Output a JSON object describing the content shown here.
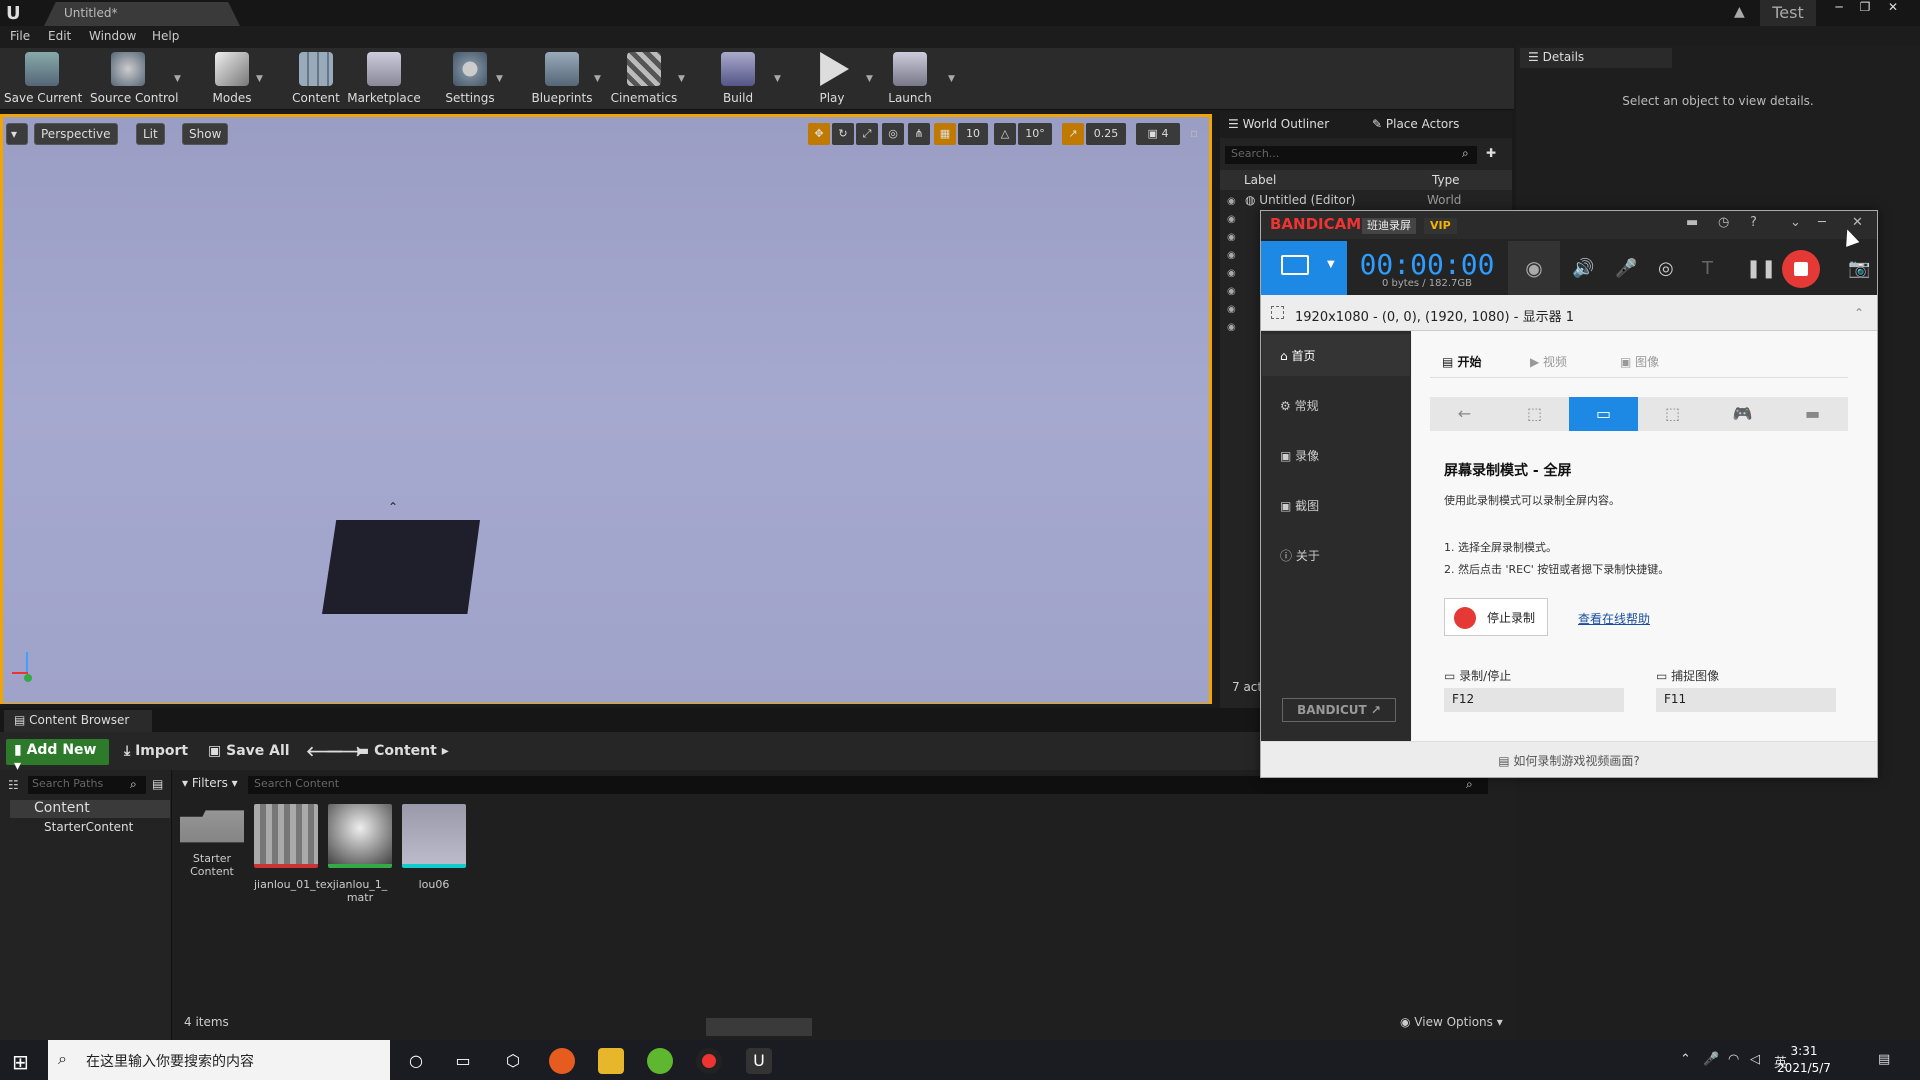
{
  "window": {
    "tab_title": "Untitled*",
    "user_label": "Test"
  },
  "menu": [
    "File",
    "Edit",
    "Window",
    "Help"
  ],
  "toolbar": {
    "items": [
      "Save Current",
      "Source Control",
      "Modes",
      "Content",
      "Marketplace",
      "Settings",
      "Blueprints",
      "Cinematics",
      "Build",
      "Play",
      "Launch"
    ]
  },
  "viewport": {
    "perspective": "Perspective",
    "lit": "Lit",
    "show": "Show",
    "grid_snap": "10",
    "rotation_snap": "10°",
    "scale_snap": "0.25",
    "camera_speed": "4"
  },
  "outliner": {
    "tab_world": "World Outliner",
    "tab_place": "Place Actors",
    "search_placeholder": "Search...",
    "col_label": "Label",
    "col_type": "Type",
    "row_label": "Untitled (Editor)",
    "row_type": "World",
    "actor_count": "7 act"
  },
  "details": {
    "tab": "Details",
    "message": "Select an object to view details."
  },
  "content_browser": {
    "tab": "Content Browser",
    "add_new": "Add New",
    "import": "Import",
    "save_all": "Save All",
    "path": "Content",
    "search_paths_placeholder": "Search Paths",
    "filters": "Filters",
    "search_content_placeholder": "Search Content",
    "tree": [
      "Content",
      "StarterContent"
    ],
    "assets": [
      {
        "label": "Starter Content"
      },
      {
        "label": "jianlou_01_tex"
      },
      {
        "label": "jianlou_1_ matr"
      },
      {
        "label": "lou06"
      }
    ],
    "items_count": "4 items",
    "view_options": "View Options"
  },
  "taskbar": {
    "search_placeholder": "在这里输入你要搜索的内容",
    "time": "3:31",
    "date": "2021/5/7",
    "ime": "英"
  },
  "bandicam": {
    "brand": "BANDICAM",
    "brand_cn": "班迪录屏",
    "vip": "VIP",
    "timer": "00:00:00",
    "size_info": "0 bytes / 182.7GB",
    "resolution": "1920x1080 - (0, 0), (1920, 1080) - 显示器 1",
    "sidebar": [
      "首页",
      "常规",
      "录像",
      "截图",
      "关于"
    ],
    "bandicut": "BANDICUT",
    "tabs": [
      "开始",
      "视频",
      "图像"
    ],
    "mode_title": "屏幕录制模式 - 全屏",
    "mode_desc": "使用此录制模式可以录制全屏内容。",
    "step1": "1. 选择全屏录制模式。",
    "step2": "2. 然后点击 'REC' 按钮或者摁下录制快捷键。",
    "stop_label": "停止录制",
    "help_link": "查看在线帮助",
    "hotkey_record_label": "录制/停止",
    "hotkey_record": "F12",
    "hotkey_capture_label": "捕捉图像",
    "hotkey_capture": "F11",
    "footer": "如何录制游戏视频画面?"
  },
  "colors": {
    "accent_orange": "#f2a400",
    "bandicam_blue": "#1e88e5",
    "rec_red": "#e53935",
    "viewport_bg": "#a6a9cf"
  }
}
